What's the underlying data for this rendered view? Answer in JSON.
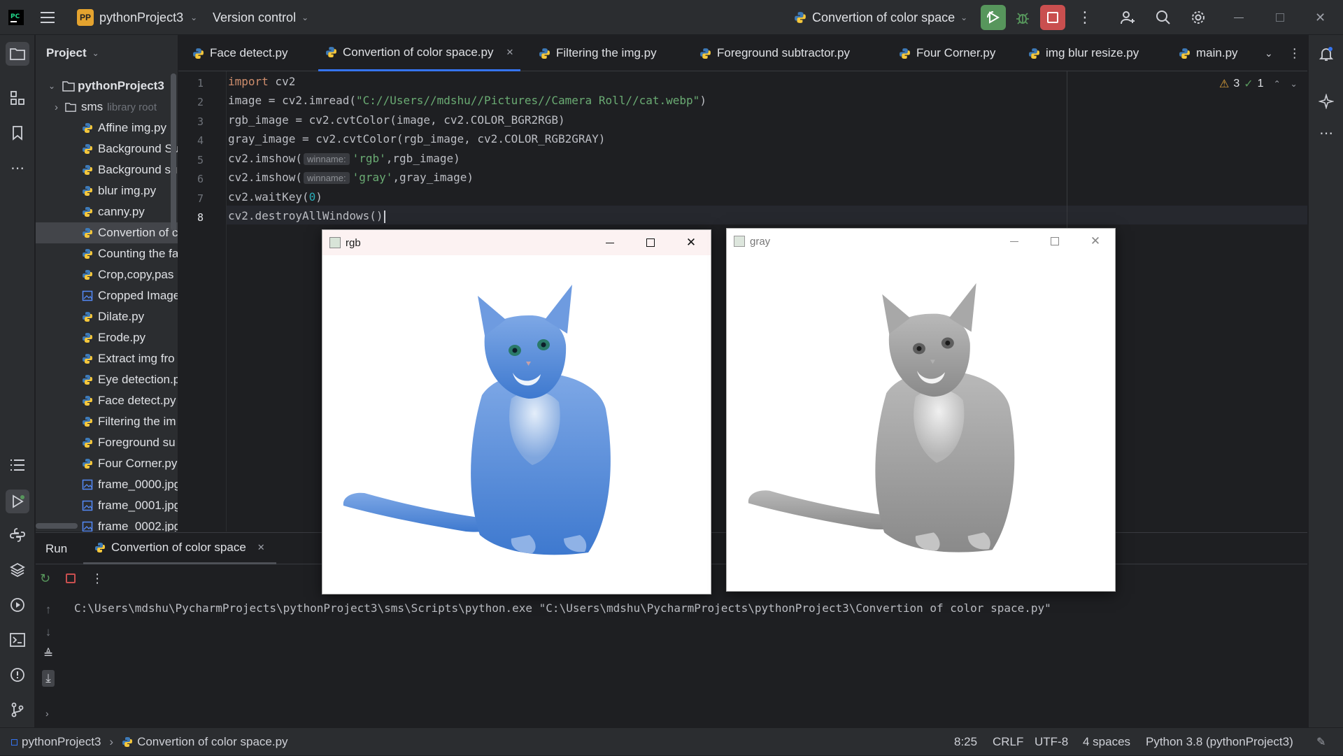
{
  "topbar": {
    "project_initials": "PP",
    "project_name": "pythonProject3",
    "vcs": "Version control",
    "run_config": "Convertion of color space"
  },
  "project_panel": {
    "title": "Project",
    "root": "pythonProject3",
    "items": [
      {
        "label": "sms",
        "suffix": "library root",
        "kind": "folder"
      },
      {
        "label": "Affine img.py",
        "kind": "py"
      },
      {
        "label": "Background Su",
        "kind": "py"
      },
      {
        "label": "Background su",
        "kind": "py"
      },
      {
        "label": "blur img.py",
        "kind": "py"
      },
      {
        "label": "canny.py",
        "kind": "py"
      },
      {
        "label": "Convertion of c",
        "kind": "py",
        "selected": true
      },
      {
        "label": "Counting the fa",
        "kind": "py"
      },
      {
        "label": "Crop,copy,pas",
        "kind": "py"
      },
      {
        "label": "Cropped Image",
        "kind": "img"
      },
      {
        "label": "Dilate.py",
        "kind": "py"
      },
      {
        "label": "Erode.py",
        "kind": "py"
      },
      {
        "label": "Extract img fro",
        "kind": "py"
      },
      {
        "label": "Eye detection.p",
        "kind": "py"
      },
      {
        "label": "Face detect.py",
        "kind": "py"
      },
      {
        "label": "Filtering the im",
        "kind": "py"
      },
      {
        "label": "Foreground su",
        "kind": "py"
      },
      {
        "label": "Four Corner.py",
        "kind": "py"
      },
      {
        "label": "frame_0000.jpg",
        "kind": "img"
      },
      {
        "label": "frame_0001.jpg",
        "kind": "img"
      },
      {
        "label": "frame_0002.jpg",
        "kind": "img"
      }
    ]
  },
  "tabs": [
    {
      "label": "Face detect.py"
    },
    {
      "label": "Convertion of color space.py",
      "active": true
    },
    {
      "label": "Filtering the img.py"
    },
    {
      "label": "Foreground subtractor.py"
    },
    {
      "label": "Four Corner.py"
    },
    {
      "label": "img blur resize.py"
    },
    {
      "label": "main.py"
    }
  ],
  "inspections": {
    "warnings": "3",
    "ok": "1"
  },
  "code": {
    "line_numbers": [
      "1",
      "2",
      "3",
      "4",
      "5",
      "6",
      "7",
      "8"
    ],
    "l1_kw": "import",
    "l1_rest": " cv2",
    "l2_a": "image = cv2.imread(",
    "l2_str": "\"C://Users//mdshu//Pictures//Camera Roll//cat.webp\"",
    "l2_b": ")",
    "l3": "rgb_image = cv2.cvtColor(image, cv2.COLOR_BGR2RGB)",
    "l4": "gray_image = cv2.cvtColor(rgb_image, cv2.COLOR_RGB2GRAY)",
    "l5_a": "cv2.imshow(",
    "l5_hint": "winname:",
    "l5_str": "'rgb'",
    "l5_b": ",rgb_image)",
    "l6_a": "cv2.imshow(",
    "l6_hint": "winname:",
    "l6_str": "'gray'",
    "l6_b": ",gray_image)",
    "l7_a": "cv2.waitKey(",
    "l7_num": "0",
    "l7_b": ")",
    "l8": "cv2.destroyAllWindows()"
  },
  "run": {
    "tab_label": "Run",
    "config_tab": "Convertion of color space",
    "output": "C:\\Users\\mdshu\\PycharmProjects\\pythonProject3\\sms\\Scripts\\python.exe \"C:\\Users\\mdshu\\PycharmProjects\\pythonProject3\\Convertion of color space.py\""
  },
  "windows": {
    "rgb_title": "rgb",
    "gray_title": "gray"
  },
  "status": {
    "crumb_project": "pythonProject3",
    "crumb_file": "Convertion of color space.py",
    "position": "8:25",
    "line_sep": "CRLF",
    "encoding": "UTF-8",
    "indent": "4 spaces",
    "interpreter": "Python 3.8 (pythonProject3)"
  },
  "colors": {
    "accent": "#3574f0",
    "run_green": "#57965c",
    "stop_red": "#c94f4f",
    "keyword": "#cf8e6d",
    "string": "#6aab73"
  }
}
